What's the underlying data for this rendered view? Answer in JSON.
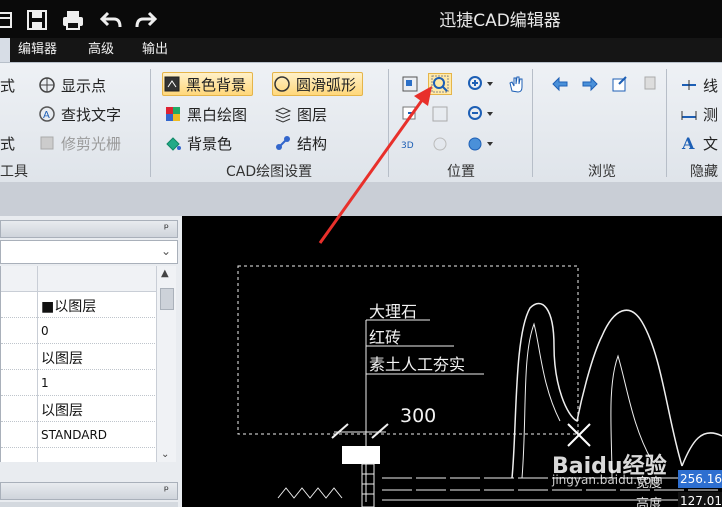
{
  "app": {
    "title": "迅捷CAD编辑器"
  },
  "menu": {
    "tabs": [
      "编辑器",
      "高级",
      "输出"
    ]
  },
  "ribbon": {
    "left_partial": [
      "式",
      "式",
      "工具"
    ],
    "display": {
      "show_points": "显示点",
      "find_text": "查找文字",
      "trim_raster": "修剪光栅"
    },
    "cad_settings": {
      "black_bg": "黑色背景",
      "smooth_arc": "圆滑弧形",
      "bw_drawing": "黑白绘图",
      "layers": "图层",
      "bg_color": "背景色",
      "structure": "结构",
      "label": "CAD绘图设置"
    },
    "position": {
      "label": "位置"
    },
    "browse": {
      "label": "浏览"
    },
    "right_partial": {
      "line": "线",
      "measure": "测",
      "text": "文",
      "hide": "隐藏"
    }
  },
  "panel": {
    "rows": [
      {
        "value": "■以图层"
      },
      {
        "value": "0"
      },
      {
        "value": "以图层"
      },
      {
        "value": "1"
      },
      {
        "value": "以图层"
      },
      {
        "value": "STANDARD"
      }
    ]
  },
  "canvas": {
    "labels": [
      "大理石",
      "红砖",
      "素土人工夯实"
    ],
    "dimension": "300"
  },
  "watermark": {
    "brand": "Baidu经验",
    "url": "jingyan.baidu.com"
  },
  "readout": {
    "width_label": "宽度",
    "width_value": "256.160",
    "height_label": "高度",
    "height_value": "127.01"
  },
  "colors": {
    "accent": "#e5b54a",
    "canvas": "#000000",
    "ribbon": "#e6eaef",
    "arrow": "#e8302b"
  }
}
